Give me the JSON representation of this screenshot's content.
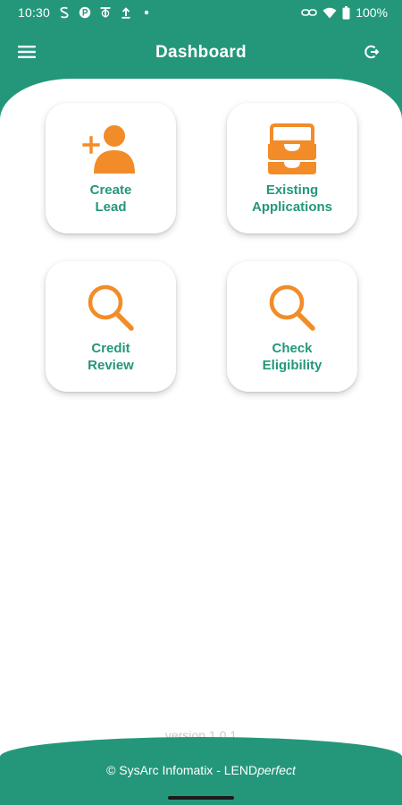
{
  "status_bar": {
    "time": "10:30",
    "battery": "100%",
    "left_icons": [
      "s-logo-icon",
      "p-logo-icon",
      "t-logo-icon",
      "upload-icon",
      "dot-icon"
    ],
    "right_icons": [
      "link-icon",
      "wifi-icon",
      "battery-icon"
    ]
  },
  "app_bar": {
    "title": "Dashboard"
  },
  "tiles": [
    {
      "label": "Create\nLead",
      "icon": "add-user-icon"
    },
    {
      "label": "Existing\nApplications",
      "icon": "inbox-tray-icon"
    },
    {
      "label": "Credit\nReview",
      "icon": "search-icon"
    },
    {
      "label": "Check\nEligibility",
      "icon": "search-icon"
    }
  ],
  "version": "version 1.0.1",
  "footer": {
    "prefix": "© SysArc Infomatix - LEND",
    "brand": "perfect"
  },
  "colors": {
    "primary": "#24977a",
    "accent": "#f28c28",
    "muted": "#c9c9c9"
  }
}
